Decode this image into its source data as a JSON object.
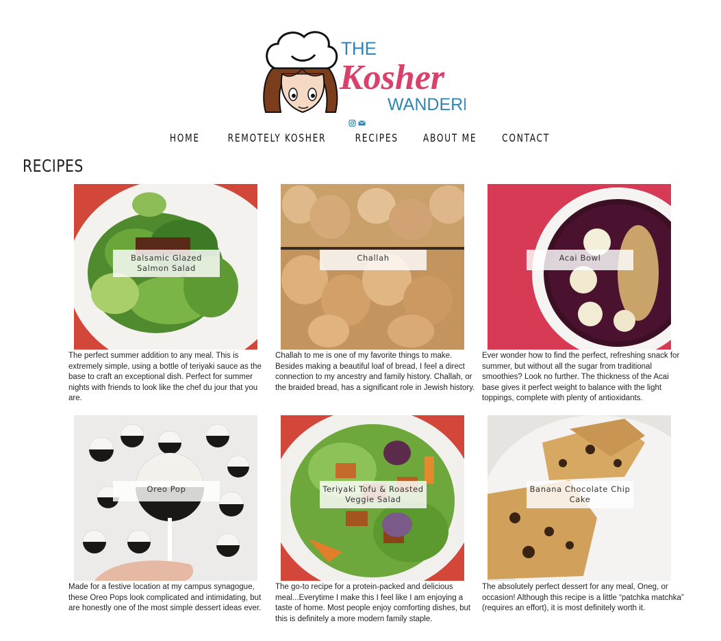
{
  "brand": {
    "line1": "THE",
    "line2": "Kosher",
    "line3": "WANDERER",
    "accent_blue": "#2e86b5",
    "accent_pink": "#d9416b"
  },
  "social": [
    {
      "icon": "instagram-icon"
    },
    {
      "icon": "envelope-icon"
    }
  ],
  "nav": [
    {
      "label": "HOME"
    },
    {
      "label": "REMOTELY KOSHER"
    },
    {
      "label": "RECIPES"
    },
    {
      "label": "ABOUT ME"
    },
    {
      "label": "CONTACT"
    }
  ],
  "page_title": "RECIPES",
  "recipes": [
    {
      "title": "Balsamic Glazed Salmon Salad",
      "desc": "The perfect summer addition to any meal. This is extremely simple, using a bottle of teriyaki sauce as the base to craft an exceptional dish. Perfect for summer nights with friends to look like the chef du jour that you are."
    },
    {
      "title": "Challah",
      "desc": "Challah to me is one of my favorite things to make. Besides making a beautiful loaf of bread, I feel a direct connection to my ancestry and family history. Challah, or the braided bread, has a significant role in Jewish history."
    },
    {
      "title": "Acai Bowl",
      "desc": "Ever wonder how to find the perfect, refreshing snack for summer, but without all the sugar from traditional smoothies? Look no further. The thickness of the Acai base gives it perfect weight to balance with the light toppings, complete with plenty of antioxidants."
    },
    {
      "title": "Oreo Pop",
      "desc": "Made for a festive location at my campus synagogue, these Oreo Pops look complicated and intimidating, but are honestly one of the most simple dessert ideas ever."
    },
    {
      "title": "Teriyaki Tofu & Roasted Veggie Salad",
      "desc": "The go-to recipe for a protein-packed and delicious meal...Everytime I make this I feel like I am enjoying a taste of home. Most people enjoy comforting dishes, but this is definitely a more modern family staple."
    },
    {
      "title": "Banana Chocolate Chip Cake",
      "desc": "The absolutely perfect dessert for any meal, Oneg, or occasion! Although this recipe is a little “patchka matchka” (requires an effort), it is most definitely worth it."
    }
  ]
}
